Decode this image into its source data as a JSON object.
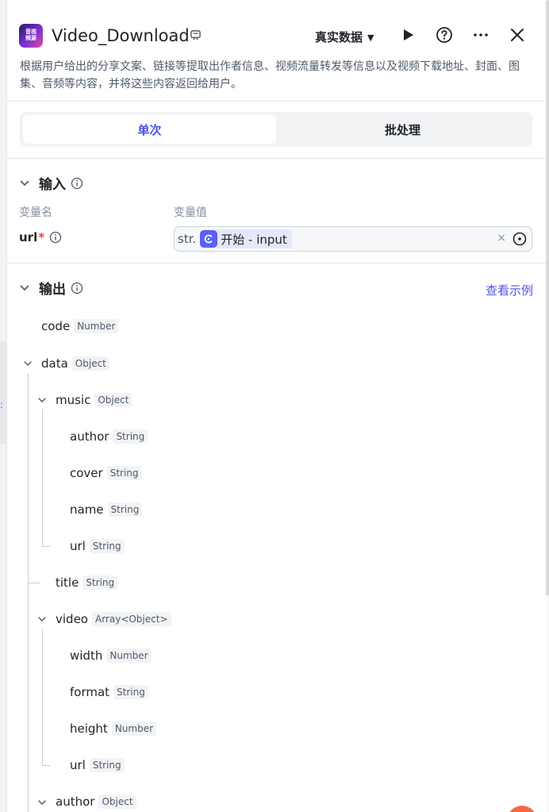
{
  "header": {
    "app_icon_line1": "音视",
    "app_icon_line2": "频源",
    "title": "Video_Download",
    "mode_label": "真实数据",
    "description": "根据用户给出的分享文案、链接等提取出作者信息、视频流量转发等信息以及视频下载地址、封面、图集、音频等内容，并将这些内容返回给用户。"
  },
  "tabs": {
    "single": "单次",
    "batch": "批处理"
  },
  "input_section": {
    "title": "输入",
    "col_name": "变量名",
    "col_value": "变量值",
    "var_name": "url",
    "required_mark": "*",
    "type_tag": "str.",
    "ref_text": "开始 - input",
    "clear": "×"
  },
  "output_section": {
    "title": "输出",
    "example_link": "查看示例"
  },
  "tree": [
    {
      "name": "code",
      "type": "Number"
    },
    {
      "name": "data",
      "type": "Object"
    },
    {
      "name": "music",
      "type": "Object"
    },
    {
      "name": "author",
      "type": "String"
    },
    {
      "name": "cover",
      "type": "String"
    },
    {
      "name": "name",
      "type": "String"
    },
    {
      "name": "url",
      "type": "String"
    },
    {
      "name": "title",
      "type": "String"
    },
    {
      "name": "video",
      "type": "Array<Object>"
    },
    {
      "name": "width",
      "type": "Number"
    },
    {
      "name": "format",
      "type": "String"
    },
    {
      "name": "height",
      "type": "Number"
    },
    {
      "name": "url",
      "type": "String"
    },
    {
      "name": "author",
      "type": "Object"
    }
  ],
  "colors": {
    "accent": "#4d53e8",
    "required": "#f53f3f",
    "ref_chip_bg": "#e6e7fc",
    "ref_icon": "#5a60f5"
  }
}
